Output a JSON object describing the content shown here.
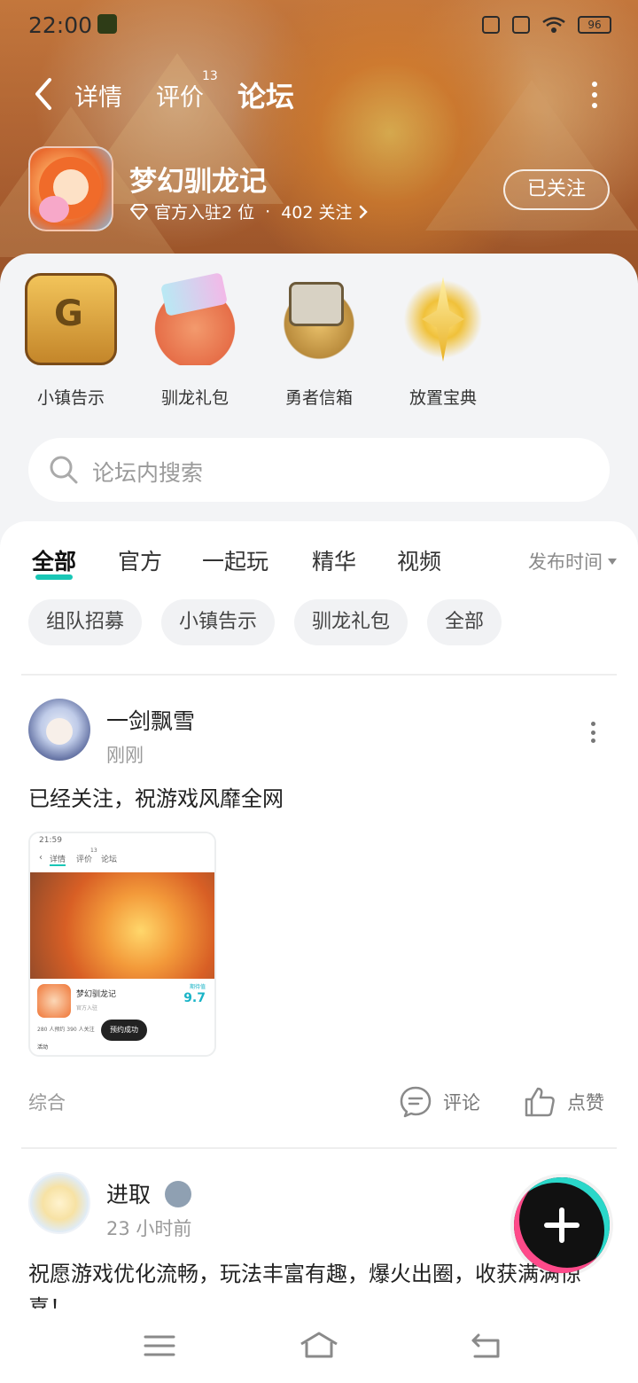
{
  "status_bar": {
    "time": "22:00",
    "battery": "96"
  },
  "header": {
    "back_icon": "chevron-left-icon",
    "tabs": [
      {
        "label": "详情",
        "active": false,
        "badge": ""
      },
      {
        "label": "评价",
        "active": false,
        "badge": "13"
      },
      {
        "label": "论坛",
        "active": true,
        "badge": ""
      }
    ],
    "more_icon": "more-vertical-icon"
  },
  "game": {
    "name": "梦幻驯龙记",
    "official_text": "官方入驻2 位",
    "separator": "·",
    "follow_count_text": "402 关注",
    "follow_button": "已关注"
  },
  "quick_links": [
    {
      "label": "小镇告示",
      "icon": "treasure-chest-icon"
    },
    {
      "label": "驯龙礼包",
      "icon": "gift-gems-icon"
    },
    {
      "label": "勇者信箱",
      "icon": "mailbox-icon"
    },
    {
      "label": "放置宝典",
      "icon": "star-compass-icon"
    }
  ],
  "search": {
    "placeholder": "论坛内搜索"
  },
  "feed_tabs": {
    "items": [
      {
        "label": "全部",
        "active": true
      },
      {
        "label": "官方",
        "active": false
      },
      {
        "label": "一起玩",
        "active": false
      },
      {
        "label": "精华",
        "active": false
      },
      {
        "label": "视频",
        "active": false
      }
    ],
    "sort_label": "发布时间"
  },
  "chips": [
    "组队招募",
    "小镇告示",
    "驯龙礼包",
    "全部"
  ],
  "posts": [
    {
      "author": "一剑飘雪",
      "time": "刚刚",
      "text": "已经关注，祝游戏风靡全网",
      "category": "综合",
      "comment_label": "评论",
      "like_label": "点赞",
      "screenshot": {
        "time": "21:59",
        "tabs": [
          "详情",
          "评价",
          "论坛"
        ],
        "tab_badge": "13",
        "title": "梦幻驯龙记",
        "sub": "官方入驻",
        "score_label": "期待值",
        "score": "9.7",
        "stats": "280 人预约   390 人关注",
        "toast": "预约成功",
        "activity": "活动"
      }
    },
    {
      "author": "进取",
      "time": "23 小时前",
      "text": "祝愿游戏优化流畅，玩法丰富有趣，爆火出圈，收获满满惊喜！"
    }
  ],
  "fab": {
    "icon": "plus-icon"
  },
  "system_nav": {
    "menu_icon": "menu-icon",
    "home_icon": "home-icon",
    "back_icon": "back-arrow-icon"
  },
  "colors": {
    "accent": "#19c7b6",
    "banner": "#c9713a",
    "sheet": "#f3f4f6"
  }
}
